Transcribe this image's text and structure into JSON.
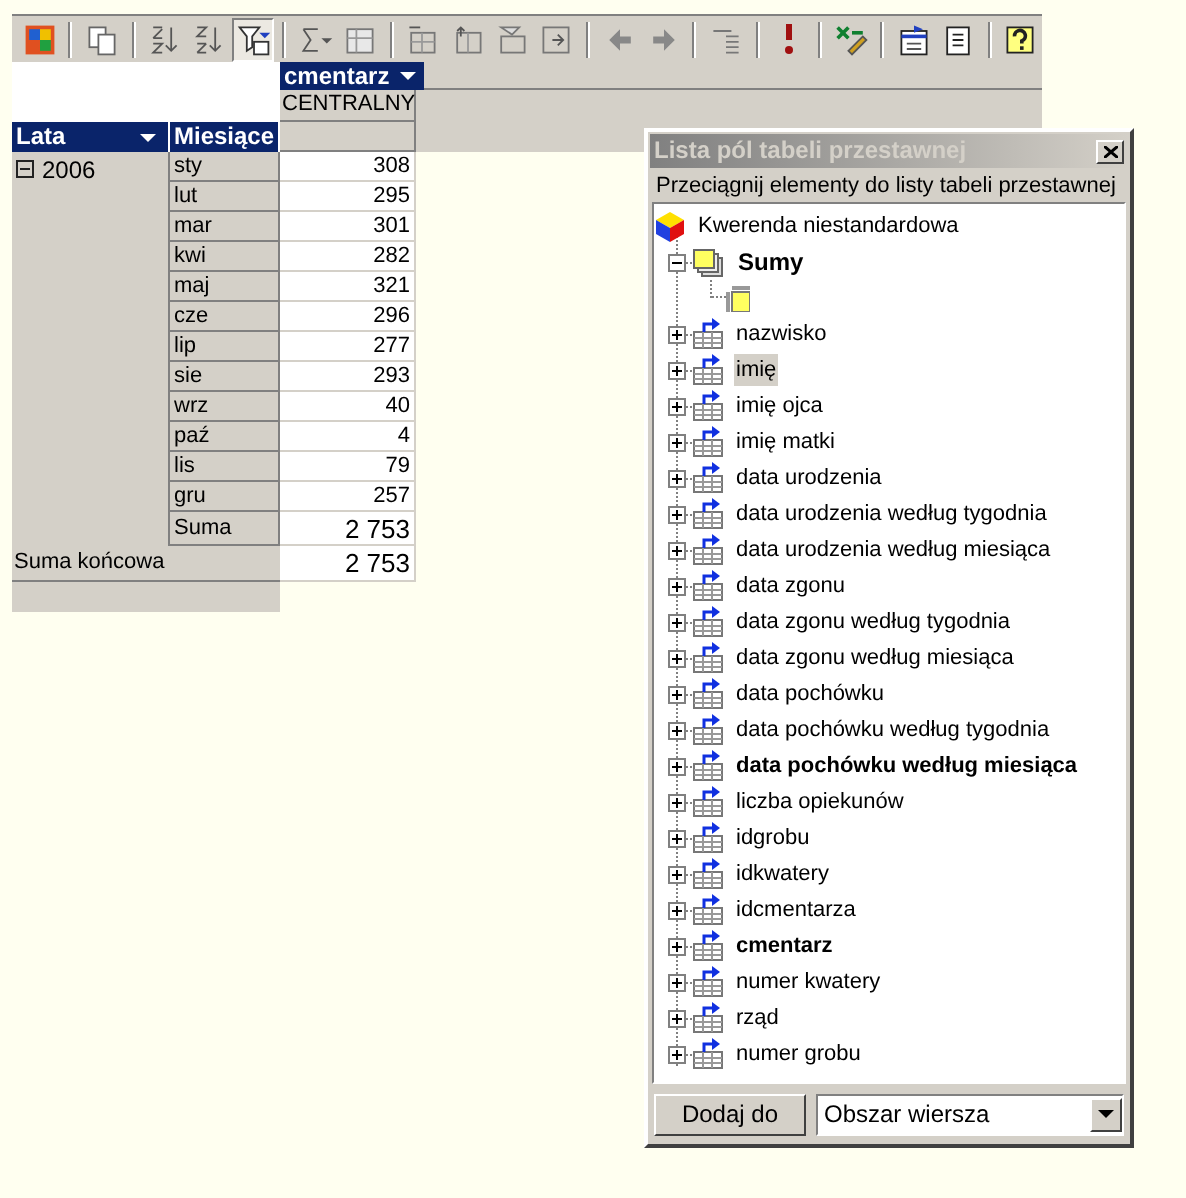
{
  "toolbar": [
    {
      "kind": "logo",
      "pressed": false
    },
    {
      "kind": "sep"
    },
    {
      "kind": "copy",
      "pressed": false
    },
    {
      "kind": "sep"
    },
    {
      "kind": "sort-asc",
      "pressed": false
    },
    {
      "kind": "sort-desc",
      "pressed": false
    },
    {
      "kind": "filter",
      "pressed": true
    },
    {
      "kind": "sep"
    },
    {
      "kind": "autosum",
      "pressed": false
    },
    {
      "kind": "calc",
      "pressed": false
    },
    {
      "kind": "sep"
    },
    {
      "kind": "promote",
      "pressed": false
    },
    {
      "kind": "demote",
      "pressed": false
    },
    {
      "kind": "drill",
      "pressed": false
    },
    {
      "kind": "expand",
      "pressed": false
    },
    {
      "kind": "sep"
    },
    {
      "kind": "left",
      "pressed": false
    },
    {
      "kind": "right",
      "pressed": false
    },
    {
      "kind": "sep"
    },
    {
      "kind": "details",
      "pressed": false
    },
    {
      "kind": "sep"
    },
    {
      "kind": "refresh",
      "pressed": false
    },
    {
      "kind": "sep"
    },
    {
      "kind": "export",
      "pressed": false
    },
    {
      "kind": "sep"
    },
    {
      "kind": "fieldlist",
      "pressed": false
    },
    {
      "kind": "properties",
      "pressed": false
    },
    {
      "kind": "sep"
    },
    {
      "kind": "help",
      "pressed": false
    }
  ],
  "pivot": {
    "column_field": "cmentarz",
    "column_items": [
      "CENTRALNY"
    ],
    "row_fields": [
      "Lata",
      "Miesiące"
    ],
    "years": [
      {
        "label": "2006",
        "expanded": true,
        "months": [
          {
            "label": "sty",
            "value": "308"
          },
          {
            "label": "lut",
            "value": "295"
          },
          {
            "label": "mar",
            "value": "301"
          },
          {
            "label": "kwi",
            "value": "282"
          },
          {
            "label": "maj",
            "value": "321"
          },
          {
            "label": "cze",
            "value": "296"
          },
          {
            "label": "lip",
            "value": "277"
          },
          {
            "label": "sie",
            "value": "293"
          },
          {
            "label": "wrz",
            "value": "40"
          },
          {
            "label": "paź",
            "value": "4"
          },
          {
            "label": "lis",
            "value": "79"
          },
          {
            "label": "gru",
            "value": "257"
          }
        ],
        "subtotal_label": "Suma",
        "subtotal": "2 753"
      }
    ],
    "grand_total_label": "Suma końcowa",
    "grand_total": "2 753"
  },
  "field_list": {
    "title": "Lista pól tabeli przestawnej",
    "hint": "Przeciągnij elementy do listy tabeli przestawnej",
    "root": "Kwerenda niestandardowa",
    "totals": {
      "label": "Sumy",
      "in_use": true,
      "expanded": true
    },
    "fields": [
      {
        "label": "nazwisko",
        "in_use": false,
        "selected": false
      },
      {
        "label": "imię",
        "in_use": false,
        "selected": true
      },
      {
        "label": "imię ojca",
        "in_use": false,
        "selected": false
      },
      {
        "label": "imię matki",
        "in_use": false,
        "selected": false
      },
      {
        "label": "data urodzenia",
        "in_use": false,
        "selected": false
      },
      {
        "label": "data urodzenia według tygodnia",
        "in_use": false,
        "selected": false
      },
      {
        "label": "data urodzenia według miesiąca",
        "in_use": false,
        "selected": false
      },
      {
        "label": "data zgonu",
        "in_use": false,
        "selected": false
      },
      {
        "label": "data zgonu według tygodnia",
        "in_use": false,
        "selected": false
      },
      {
        "label": "data zgonu według miesiąca",
        "in_use": false,
        "selected": false
      },
      {
        "label": "data pochówku",
        "in_use": false,
        "selected": false
      },
      {
        "label": "data pochówku według tygodnia",
        "in_use": false,
        "selected": false
      },
      {
        "label": "data pochówku według miesiąca",
        "in_use": true,
        "selected": false
      },
      {
        "label": "liczba opiekunów",
        "in_use": false,
        "selected": false
      },
      {
        "label": "idgrobu",
        "in_use": false,
        "selected": false
      },
      {
        "label": "idkwatery",
        "in_use": false,
        "selected": false
      },
      {
        "label": "idcmentarza",
        "in_use": false,
        "selected": false
      },
      {
        "label": "cmentarz",
        "in_use": true,
        "selected": false
      },
      {
        "label": "numer kwatery",
        "in_use": false,
        "selected": false
      },
      {
        "label": "rząd",
        "in_use": false,
        "selected": false
      },
      {
        "label": "numer grobu",
        "in_use": false,
        "selected": false
      }
    ],
    "add_button": "Dodaj do",
    "area_select": "Obszar wiersza"
  }
}
